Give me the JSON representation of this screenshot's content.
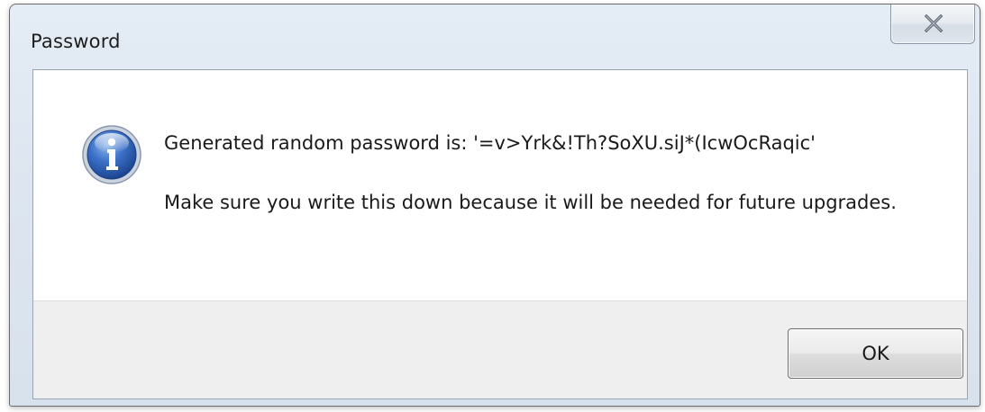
{
  "window": {
    "title": "Password",
    "close_icon": "close-x-icon"
  },
  "message": {
    "icon": "information-icon",
    "line1": "Generated random password is: '=v>Yrk&!Th?SoXU.siJ*(IcwOcRaqic'",
    "line2": "Make sure you write this down because it will be needed for future upgrades."
  },
  "buttons": {
    "ok_label": "OK"
  },
  "colors": {
    "info_icon_blue": "#2f5fb0",
    "frame_border": "#6b6b6b",
    "button_area": "#efefef"
  }
}
